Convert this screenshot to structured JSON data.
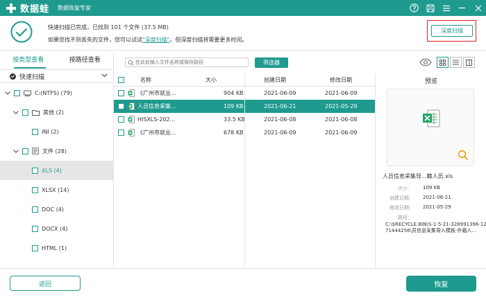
{
  "app": {
    "brand": "数据蛙",
    "subtitle": "数据恢复专家",
    "accent": "#1f9a8e"
  },
  "status": {
    "line1": "快速扫描已完成，已找到 101 个文件 (37.5 MB)",
    "line2_prefix": "如果您找不到丢失的文件，您可以试试",
    "line2_link": "\"深度扫描\"",
    "line2_suffix": "。但深度扫描将需要更多时间。",
    "deep_scan_label": "深度扫描"
  },
  "left": {
    "tabs": [
      "按类型查看",
      "按路径查看"
    ],
    "quick_scan": "快速扫描",
    "tree": [
      {
        "label": "C:(NTFS) (79)",
        "indent": 0,
        "chevron": "∨",
        "icon": "drive-icon"
      },
      {
        "label": "其他 (2)",
        "indent": 1,
        "chevron": "∨",
        "icon": "folder-icon"
      },
      {
        "label": "INI (2)",
        "indent": 2,
        "chevron": "",
        "icon": ""
      },
      {
        "label": "文件 (28)",
        "indent": 1,
        "chevron": "∨",
        "icon": "document-icon"
      },
      {
        "label": "XLS (4)",
        "indent": 2,
        "chevron": "",
        "icon": "",
        "selected": true
      },
      {
        "label": "XLSX (14)",
        "indent": 2,
        "chevron": "",
        "icon": ""
      },
      {
        "label": "DOC (4)",
        "indent": 2,
        "chevron": "",
        "icon": ""
      },
      {
        "label": "DOCX (4)",
        "indent": 2,
        "chevron": "",
        "icon": ""
      },
      {
        "label": "HTML (1)",
        "indent": 2,
        "chevron": "",
        "icon": ""
      }
    ]
  },
  "toolbar": {
    "search_placeholder": "在此处输入文件名称或保存路径",
    "filter_label": "筛选器"
  },
  "table": {
    "headers": [
      "名称",
      "大小",
      "创建日期",
      "修改日期"
    ],
    "rows": [
      {
        "name": "《广州市就业...",
        "size": "904 KB",
        "created": "2021-06-09",
        "modified": "2021-06-09",
        "selected": false
      },
      {
        "name": "人员信息采集...",
        "size": "109 KB",
        "created": "2021-06-21",
        "modified": "2021-05-29",
        "selected": true
      },
      {
        "name": "HISXLS-202...",
        "size": "33.5 KB",
        "created": "2021-06-08",
        "modified": "2021-06-08",
        "selected": false
      },
      {
        "name": "《广州市就业...",
        "size": "678 KB",
        "created": "2021-06-09",
        "modified": "2021-06-09",
        "selected": false
      }
    ]
  },
  "preview": {
    "title": "预览",
    "file_name": "人员信息采集导...籍人员.xls",
    "size_label": "大小：",
    "size_value": "109 KB",
    "created_label": "创建日期：",
    "created_value": "2021-06-21",
    "modified_label": "修改日期：",
    "modified_value": "2021-05-29",
    "path_label": "路径：",
    "path_value": "C:\\$RECYCLE.BIN\\S-1-5-21-328991396-1271444256\\员信息采集导入模板-外籍人..."
  },
  "footer": {
    "back_label": "返回",
    "recover_label": "恢复"
  }
}
